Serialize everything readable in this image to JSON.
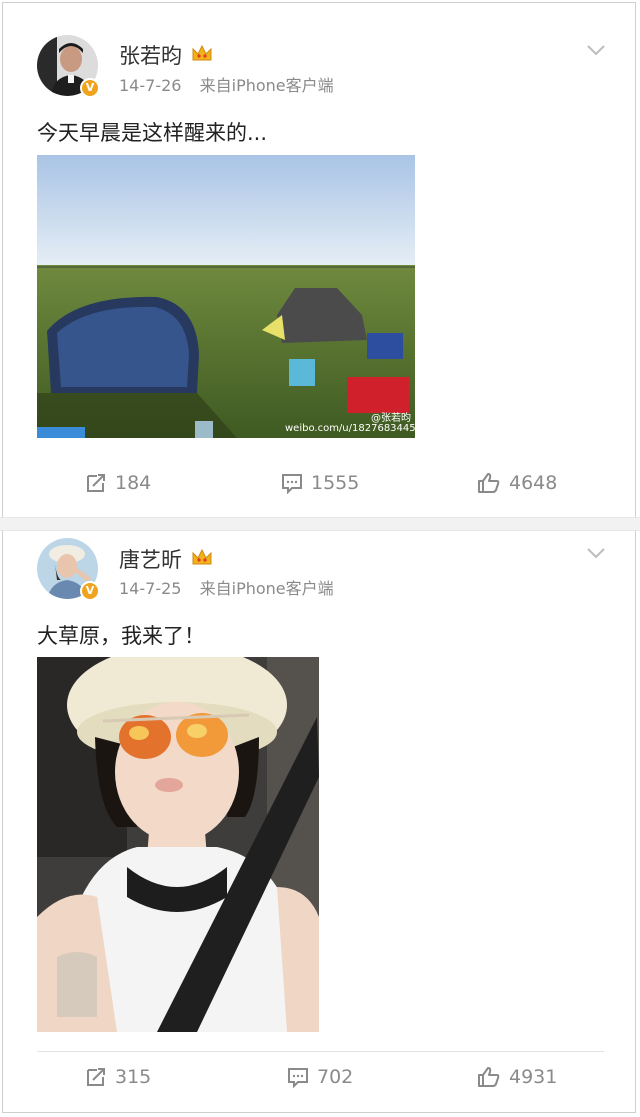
{
  "posts": [
    {
      "author": "张若昀",
      "date": "14-7-26",
      "source": "来自iPhone客户端",
      "text": "今天早晨是这样醒来的...",
      "watermark_user": "@张若昀",
      "watermark_url": "weibo.com/u/1827683445",
      "reposts": "184",
      "comments": "1555",
      "likes": "4648",
      "verified_badge": "V"
    },
    {
      "author": "唐艺昕",
      "date": "14-7-25",
      "source": "来自iPhone客户端",
      "text": "大草原，我来了！",
      "reposts": "315",
      "comments": "702",
      "likes": "4931",
      "verified_badge": "V"
    }
  ],
  "colors": {
    "badge": "#f0a31c",
    "meta_text": "#8a8a8a",
    "separator": "#f2f2f2"
  },
  "icons": [
    "repost-icon",
    "comment-icon",
    "like-icon",
    "chevron-down-icon",
    "crown-icon"
  ]
}
